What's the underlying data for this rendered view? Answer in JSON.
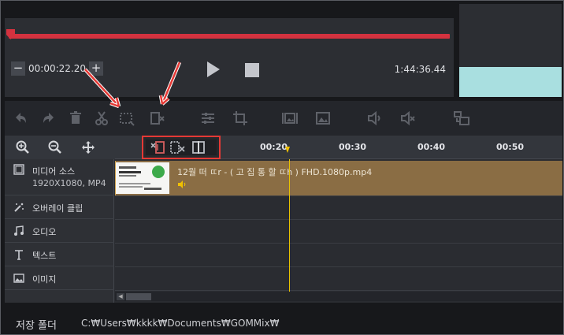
{
  "player": {
    "timecode": "00:00:22.20",
    "minus_label": "−",
    "plus_label": "+",
    "total_time": "1:44:36.44",
    "progress_color": "#d3323f"
  },
  "toolbar": {
    "icons": [
      "undo-icon",
      "redo-icon",
      "delete-icon",
      "cut-icon",
      "select-region-icon",
      "split-clip-icon",
      "adjust-icon",
      "crop-icon",
      "image-insert-icon",
      "image-icon",
      "volume-icon",
      "mute-icon",
      "screen-capture-icon"
    ]
  },
  "timeline": {
    "ticks": [
      "00:20",
      "00:30",
      "00:40",
      "00:50"
    ],
    "tracks": [
      {
        "label": "미디어 소스",
        "sublabel": "1920X1080, MP4"
      },
      {
        "label": "오버레이 클립"
      },
      {
        "label": "오디오"
      },
      {
        "label": "텍스트"
      },
      {
        "label": "이미지"
      }
    ],
    "clip": {
      "name": "12월 떠 ㄸr - ( 고  집 통 할  ㄸh ) FHD.1080p.mp4",
      "color": "#8a6d44"
    },
    "playhead_color": "#e8c200"
  },
  "footer": {
    "label": "저장 폴더",
    "path": "C:₩Users₩kkkk₩Documents₩GOMMix₩"
  },
  "annotation_color": "#e53935"
}
